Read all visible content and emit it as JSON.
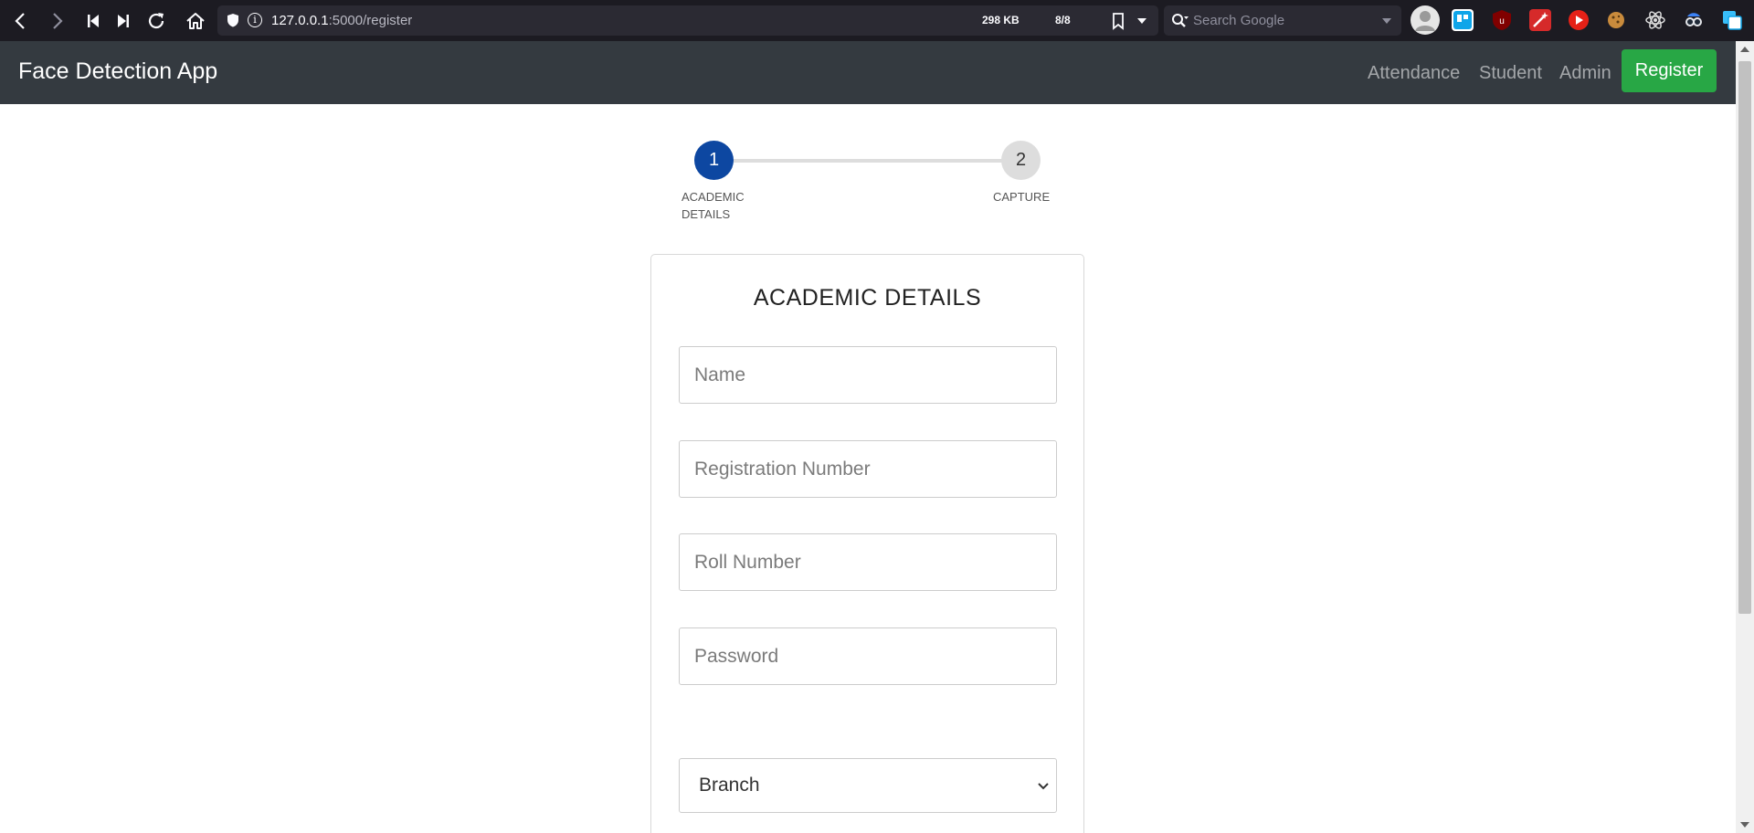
{
  "browser": {
    "url_host": "127.0.0.1",
    "url_path": ":5000/register",
    "page_size": "298 KB",
    "page_count": "8/8",
    "search_placeholder": "Search Google",
    "icons": [
      "back-icon",
      "forward-icon",
      "skip-back-icon",
      "skip-forward-icon",
      "reload-icon",
      "home-icon",
      "shield-icon",
      "info-icon",
      "bookmark-icon",
      "search-icon"
    ]
  },
  "navbar": {
    "brand": "Face Detection App",
    "links": [
      "Attendance",
      "Student",
      "Admin"
    ],
    "register_label": "Register",
    "bg_color": "#343a40",
    "register_color": "#28a745"
  },
  "stepper": {
    "steps": [
      {
        "number": "1",
        "label_line1": "ACADEMIC",
        "label_line2": "DETAILS",
        "active": true
      },
      {
        "number": "2",
        "label_line1": "CAPTURE",
        "label_line2": "",
        "active": false
      }
    ],
    "active_color": "#0d47a1"
  },
  "form": {
    "title": "ACADEMIC DETAILS",
    "name_placeholder": "Name",
    "registration_placeholder": "Registration Number",
    "roll_placeholder": "Roll Number",
    "password_placeholder": "Password",
    "branch_selected": "Branch"
  }
}
